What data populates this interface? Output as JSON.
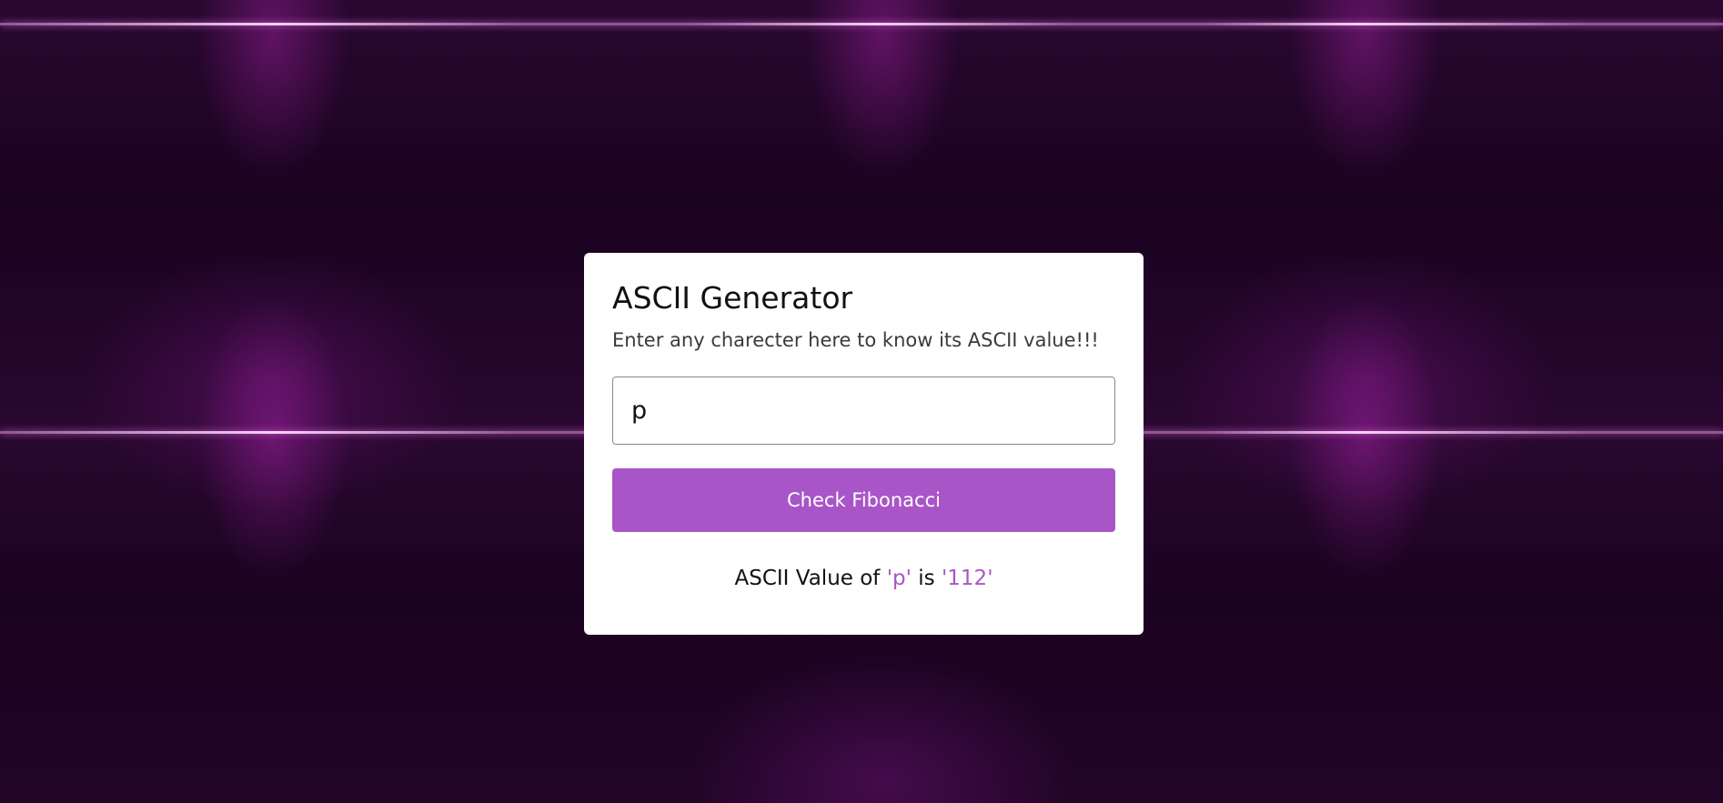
{
  "colors": {
    "accent": "#a855c8",
    "card_background": "#ffffff",
    "page_background": "#1f0420"
  },
  "card": {
    "title": "ASCII Generator",
    "subtitle": "Enter any charecter here to know its ASCII value!!!",
    "input_value": "p",
    "button_label": "Check Fibonacci",
    "result": {
      "prefix": "ASCII Value of ",
      "character": "'p'",
      "middle": " is ",
      "value": "'112'"
    }
  }
}
